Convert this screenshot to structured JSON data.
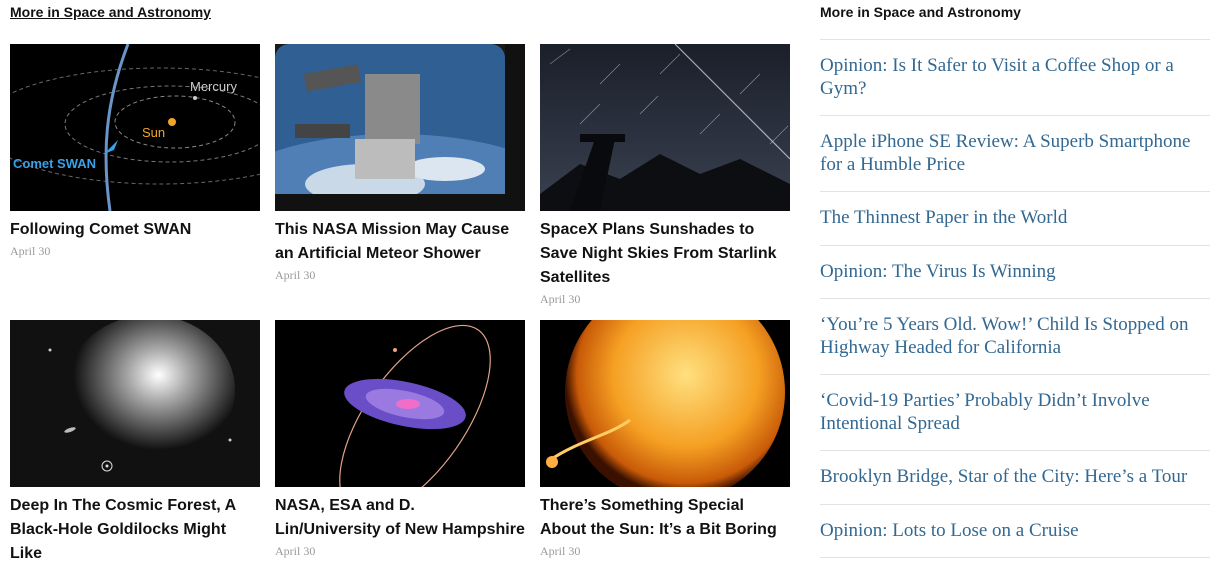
{
  "section_label": "More in Space and Astronomy",
  "cards": [
    {
      "title": "Following Comet SWAN",
      "date": "April 30",
      "image": {
        "labels": [
          "Mercury",
          "Sun",
          "Comet SWAN"
        ]
      }
    },
    {
      "title": "This NASA Mission May Cause an Artificial Meteor Shower",
      "date": "April 30"
    },
    {
      "title": "SpaceX Plans Sunshades to Save Night Skies From Starlink Satellites",
      "date": "April 30"
    },
    {
      "title": "Deep In The Cosmic Forest, A Black-Hole Goldilocks Might Like",
      "date": ""
    },
    {
      "title": "NASA, ESA and D. Lin/University of New Hampshire",
      "date": "April 30"
    },
    {
      "title": "There’s Something Special About the Sun: It’s a Bit Boring",
      "date": "April 30"
    }
  ],
  "sidebar": {
    "heading": "More in Space and Astronomy",
    "items": [
      "Opinion: Is It Safer to Visit a Coffee Shop or a Gym?",
      "Apple iPhone SE Review: A Superb Smartphone for a Humble Price",
      "The Thinnest Paper in the World",
      "Opinion: The Virus Is Winning",
      "‘You’re 5 Years Old. Wow!’ Child Is Stopped on Highway Headed for California",
      "‘Covid-19 Parties’ Probably Didn’t Involve Intentional Spread",
      "Brooklyn Bridge, Star of the City: Here’s a Tour",
      "Opinion: Lots to Lose on a Cruise"
    ]
  }
}
